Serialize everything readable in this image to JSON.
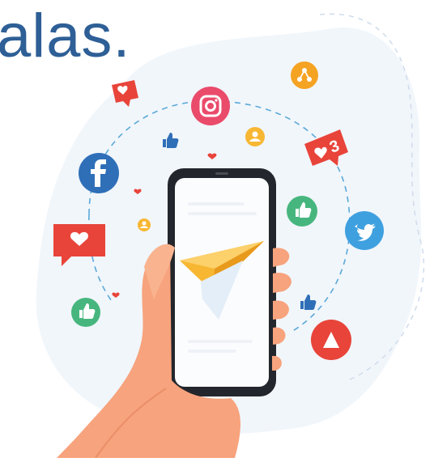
{
  "heading": {
    "text": "alas."
  },
  "illustration": {
    "subject": "hand-holding-smartphone",
    "center_icon": "paper-plane-icon",
    "icons": [
      "facebook-icon",
      "instagram-icon",
      "twitter-bird-icon",
      "youtube-play-icon",
      "share-icon",
      "user-icon",
      "like-thumb-icon",
      "heart-chat-icon",
      "heart-icon"
    ],
    "notification_count": "3"
  },
  "colors": {
    "heading": "#2e5f96",
    "blob": "#f1f6fb",
    "facebook": "#2f6fb8",
    "instagram": "#ea4b6b",
    "twitter": "#3fa0df",
    "youtube": "#e8443a",
    "share": "#f5a323",
    "like_green": "#47b67e",
    "heart_red": "#e8443a",
    "plane_yellow": "#f7b733",
    "skin": "#f7a37d",
    "phone": "#23262c"
  }
}
